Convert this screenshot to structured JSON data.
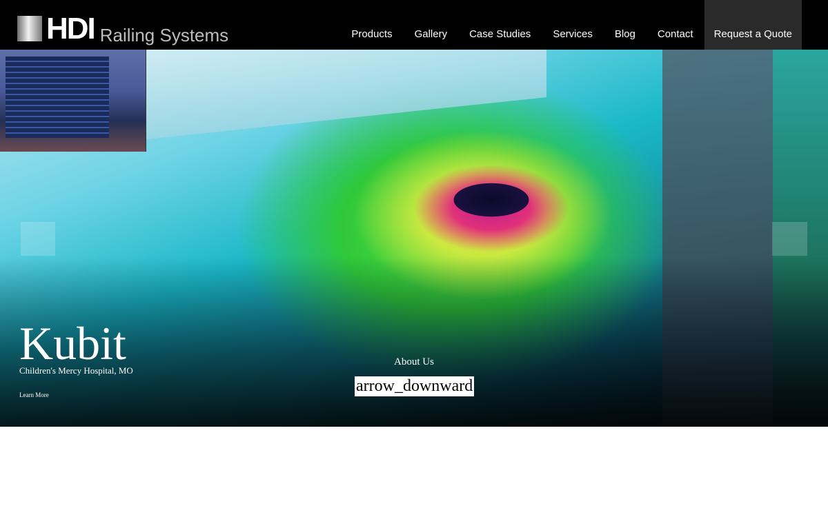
{
  "header": {
    "logo": {
      "brand": "HDI",
      "tagline": "Railing Systems"
    },
    "nav": [
      {
        "label": "Products"
      },
      {
        "label": "Gallery"
      },
      {
        "label": "Case Studies"
      },
      {
        "label": "Services"
      },
      {
        "label": "Blog"
      },
      {
        "label": "Contact"
      }
    ],
    "cta_label": "Request a Quote"
  },
  "hero": {
    "title": "Kubit",
    "subtitle": "Children's Mercy Hospital, MO",
    "link_label": "Learn More",
    "about_label": "About Us",
    "arrow_icon_text": "arrow_downward"
  },
  "colors": {
    "header_bg": "#000000",
    "cta_bg": "#2a2a2a",
    "text_light": "#ffffff"
  }
}
